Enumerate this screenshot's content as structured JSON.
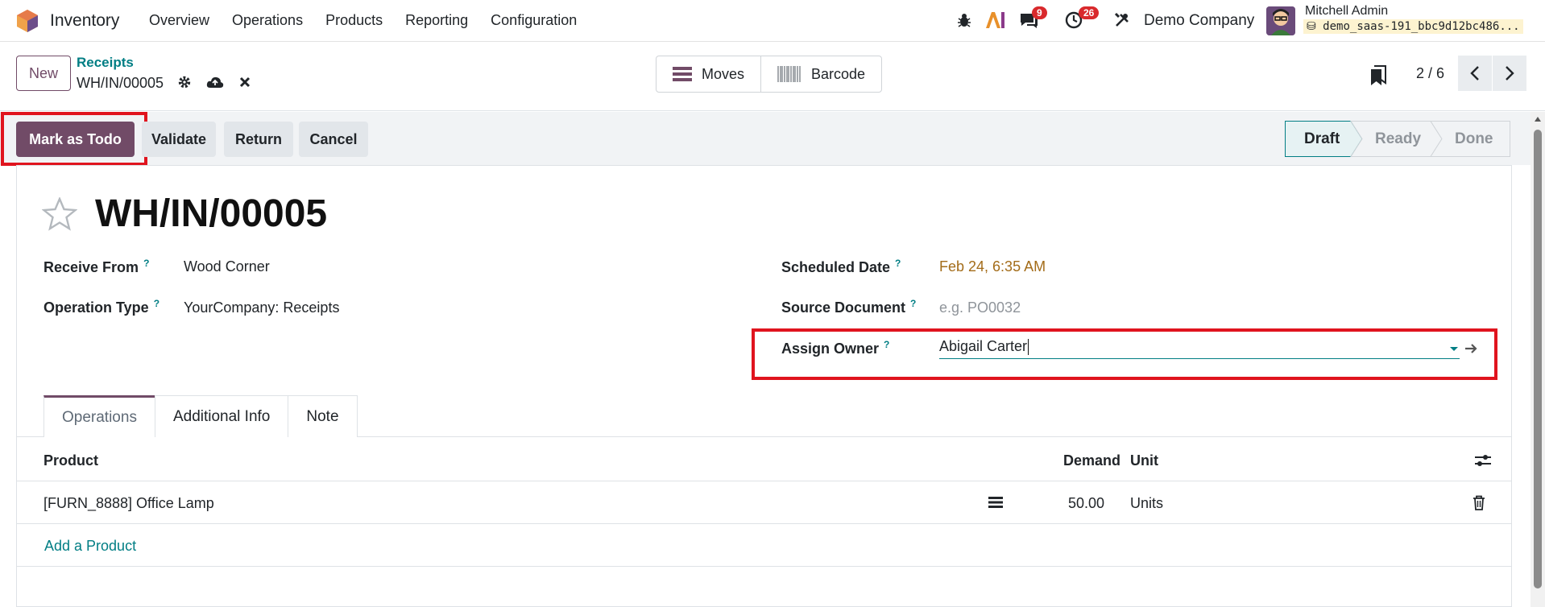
{
  "navbar": {
    "app_name": "Inventory",
    "menu": [
      "Overview",
      "Operations",
      "Products",
      "Reporting",
      "Configuration"
    ],
    "messages_count": "9",
    "activities_count": "26",
    "company": "Demo Company",
    "user_name": "Mitchell Admin",
    "db_name": "demo_saas-191_bbc9d12bc486..."
  },
  "control": {
    "new_label": "New",
    "breadcrumb_parent": "Receipts",
    "breadcrumb_current": "WH/IN/00005",
    "views": [
      "Moves",
      "Barcode"
    ],
    "pager": "2 / 6"
  },
  "actions": {
    "mark_todo": "Mark as Todo",
    "validate": "Validate",
    "return": "Return",
    "cancel": "Cancel"
  },
  "status": {
    "stages": [
      "Draft",
      "Ready",
      "Done"
    ],
    "current": "Draft"
  },
  "record": {
    "title": "WH/IN/00005",
    "fields": {
      "receive_from_label": "Receive From",
      "receive_from": "Wood Corner",
      "operation_type_label": "Operation Type",
      "operation_type": "YourCompany: Receipts",
      "scheduled_date_label": "Scheduled Date",
      "scheduled_date": "Feb 24, 6:35 AM",
      "source_document_label": "Source Document",
      "source_document_placeholder": "e.g. PO0032",
      "assign_owner_label": "Assign Owner",
      "assign_owner": "Abigail Carter"
    },
    "help_mark": "?"
  },
  "tabs": [
    "Operations",
    "Additional Info",
    "Note"
  ],
  "table": {
    "headers": {
      "product": "Product",
      "demand": "Demand",
      "unit": "Unit"
    },
    "rows": [
      {
        "product": "[FURN_8888] Office Lamp",
        "demand": "50.00",
        "unit": "Units"
      }
    ],
    "add_product": "Add a Product"
  },
  "colors": {
    "primary": "#714b67",
    "link": "#017e84",
    "highlight": "#e0141e",
    "date": "#a36c19"
  }
}
